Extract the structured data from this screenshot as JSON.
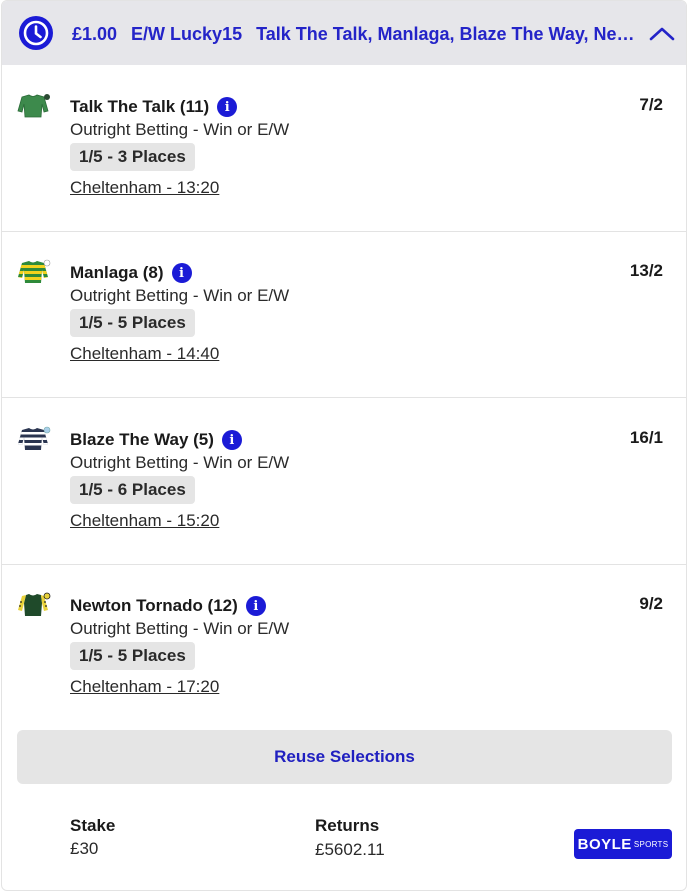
{
  "header": {
    "stake": "£1.00",
    "bet_type": "E/W Lucky15",
    "selections_summary": "Talk The Talk, Manlaga, Blaze The Way, Newton Tornado",
    "icon": "clock-icon",
    "collapse_icon": "chevron-up-icon"
  },
  "selections": [
    {
      "name": "Talk The Talk (11)",
      "odds": "7/2",
      "market": "Outright Betting - Win or E/W",
      "places": "1/5 - 3 Places",
      "race": "Cheltenham - 13:20",
      "silk": "green-silk-icon"
    },
    {
      "name": "Manlaga (8)",
      "odds": "13/2",
      "market": "Outright Betting - Win or E/W",
      "places": "1/5 - 5 Places",
      "race": "Cheltenham - 14:40",
      "silk": "green-yellow-hoops-silk-icon"
    },
    {
      "name": "Blaze The Way (5)",
      "odds": "16/1",
      "market": "Outright Betting - Win or E/W",
      "places": "1/5 - 6 Places",
      "race": "Cheltenham - 15:20",
      "silk": "navy-white-hoops-silk-icon"
    },
    {
      "name": "Newton Tornado (12)",
      "odds": "9/2",
      "market": "Outright Betting - Win or E/W",
      "places": "1/5 - 5 Places",
      "race": "Cheltenham - 17:20",
      "silk": "dark-green-yellow-sleeves-silk-icon"
    }
  ],
  "reuse_label": "Reuse Selections",
  "footer": {
    "stake_label": "Stake",
    "stake_value": "£30",
    "returns_label": "Returns",
    "returns_value": "£5602.11",
    "brand_main": "BOYLE",
    "brand_sub": "SPORTS"
  },
  "colors": {
    "accent": "#1b1bd6",
    "header_bg": "#e6e6ea",
    "chip_bg": "#e5e5e5"
  }
}
